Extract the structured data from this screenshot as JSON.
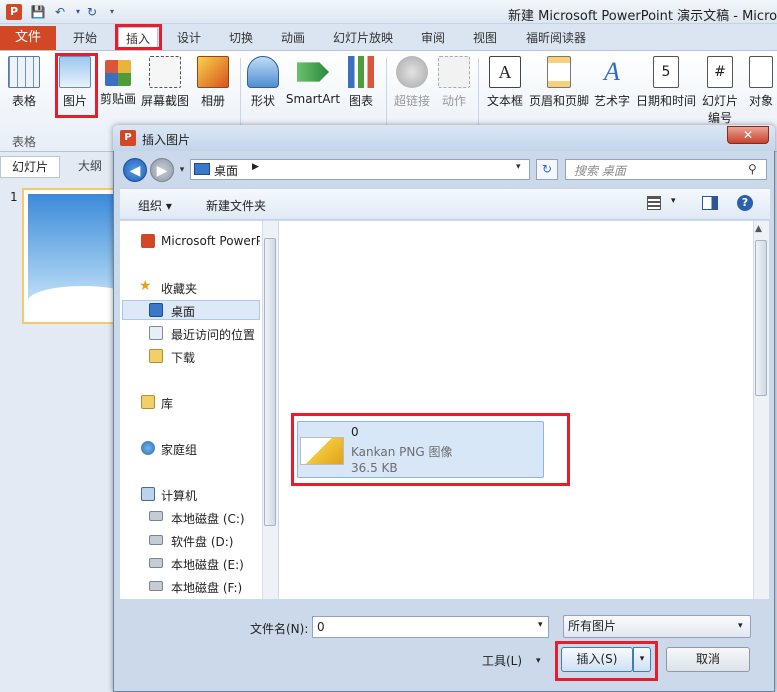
{
  "window": {
    "title": "新建 Microsoft PowerPoint 演示文稿 - Microso",
    "app_icon": "P"
  },
  "quick_access": [
    "save-icon",
    "undo-icon",
    "redo-icon"
  ],
  "tabs": {
    "file": "文件",
    "home": "开始",
    "insert": "插入",
    "design": "设计",
    "transitions": "切换",
    "animations": "动画",
    "slideshow": "幻灯片放映",
    "review": "审阅",
    "view": "视图",
    "reader": "福昕阅读器"
  },
  "ribbon": {
    "table": "表格",
    "picture": "图片",
    "clipart": "剪贴画",
    "screenshot": "屏幕截图",
    "album": "相册",
    "shapes": "形状",
    "smartart": "SmartArt",
    "chart": "图表",
    "hyperlink": "超链接",
    "action": "动作",
    "textbox": "文本框",
    "header_footer": "页眉和页脚",
    "wordart": "艺术字",
    "datetime": "日期和时间",
    "slide_number_1": "幻灯片",
    "slide_number_2": "编号",
    "object": "对象",
    "group_table": "表格"
  },
  "slide_panel": {
    "slides_tab": "幻灯片",
    "outline_tab": "大纲",
    "slide_number": "1"
  },
  "dialog": {
    "title": "插入图片",
    "close": "✕",
    "address": "桌面",
    "search_placeholder": "搜索 桌面",
    "organize": "组织 ▾",
    "new_folder": "新建文件夹",
    "nav_items": [
      "Microsoft PowerP",
      "收藏夹",
      "桌面",
      "最近访问的位置",
      "下载",
      "库",
      "家庭组",
      "计算机",
      "本地磁盘 (C:)",
      "软件盘 (D:)",
      "本地磁盘 (E:)",
      "本地磁盘 (F:)"
    ],
    "file": {
      "name": "0",
      "type": "Kankan PNG 图像",
      "size": "36.5 KB"
    },
    "filename_label": "文件名(N):",
    "filename_value": "0",
    "filetype": "所有图片",
    "tools": "工具(L)",
    "insert": "插入(S)",
    "cancel": "取消"
  },
  "colors": {
    "file_tab": "#d24726",
    "highlight_box": "#e61d2b",
    "selected_file": "#d7e7f8"
  }
}
